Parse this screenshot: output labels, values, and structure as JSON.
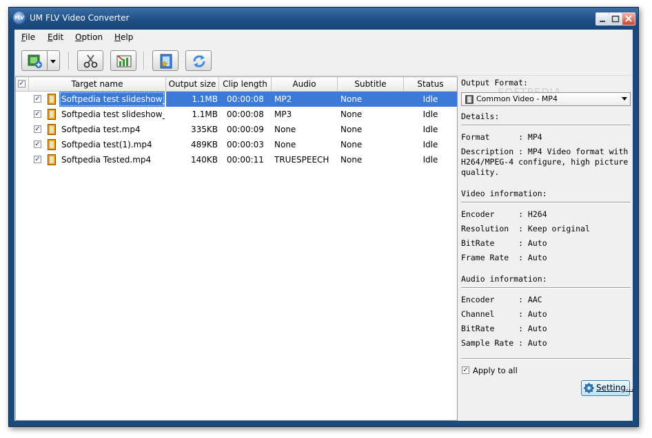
{
  "window": {
    "title": "UM FLV Video Converter",
    "icon_text": "FLV"
  },
  "menu": [
    {
      "label": "File",
      "mnemonic": "F",
      "rest": "ile"
    },
    {
      "label": "Edit",
      "mnemonic": "E",
      "rest": "dit"
    },
    {
      "label": "Option",
      "mnemonic": "O",
      "rest": "ption"
    },
    {
      "label": "Help",
      "mnemonic": "H",
      "rest": "elp"
    }
  ],
  "toolbar": {
    "icons": [
      "add-video-icon",
      "dropdown-arrow-icon",
      "scissors-icon",
      "chart-icon",
      "film-star-icon",
      "convert-icon"
    ]
  },
  "table": {
    "headers": [
      "Target name",
      "Output size",
      "Clip length",
      "Audio",
      "Subtitle",
      "Status"
    ],
    "rows": [
      {
        "name": "Softpedia test slideshow_E...",
        "size": "1.1MB",
        "length": "00:00:08",
        "audio": "MP2",
        "subtitle": "None",
        "status": "Idle",
        "selected": true
      },
      {
        "name": "Softpedia test slideshow_...",
        "size": "1.1MB",
        "length": "00:00:08",
        "audio": "MP3",
        "subtitle": "None",
        "status": "Idle",
        "selected": false
      },
      {
        "name": "Softpedia test.mp4",
        "size": "335KB",
        "length": "00:00:09",
        "audio": "None",
        "subtitle": "None",
        "status": "Idle",
        "selected": false
      },
      {
        "name": "Softpedia test(1).mp4",
        "size": "489KB",
        "length": "00:00:03",
        "audio": "None",
        "subtitle": "None",
        "status": "Idle",
        "selected": false
      },
      {
        "name": "Softpedia Tested.mp4",
        "size": "140KB",
        "length": "00:00:11",
        "audio": "TRUESPEECH",
        "subtitle": "None",
        "status": "Idle",
        "selected": false
      }
    ]
  },
  "right": {
    "output_format_label": "Output Format:",
    "format_value": "Common Video - MP4",
    "details_label": "Details:",
    "format_line": "Format      : MP4",
    "description_line1": "Description : MP4 Video format with",
    "description_line2": "H264/MPEG-4 configure, high picture",
    "description_line3": "quality.",
    "video_info_label": "Video information:",
    "video_lines": [
      "Encoder     : H264",
      "Resolution  : Keep original",
      "BitRate     : Auto",
      "Frame Rate  : Auto"
    ],
    "audio_info_label": "Audio information:",
    "audio_lines": [
      "Encoder     : AAC",
      "Channel     : Auto",
      "BitRate     : Auto",
      "Sample Rate : Auto"
    ],
    "apply_all_label": "Apply to all",
    "apply_all_checked": true,
    "setting_button": "Setting...",
    "watermark": "SOFTPEDIA"
  }
}
